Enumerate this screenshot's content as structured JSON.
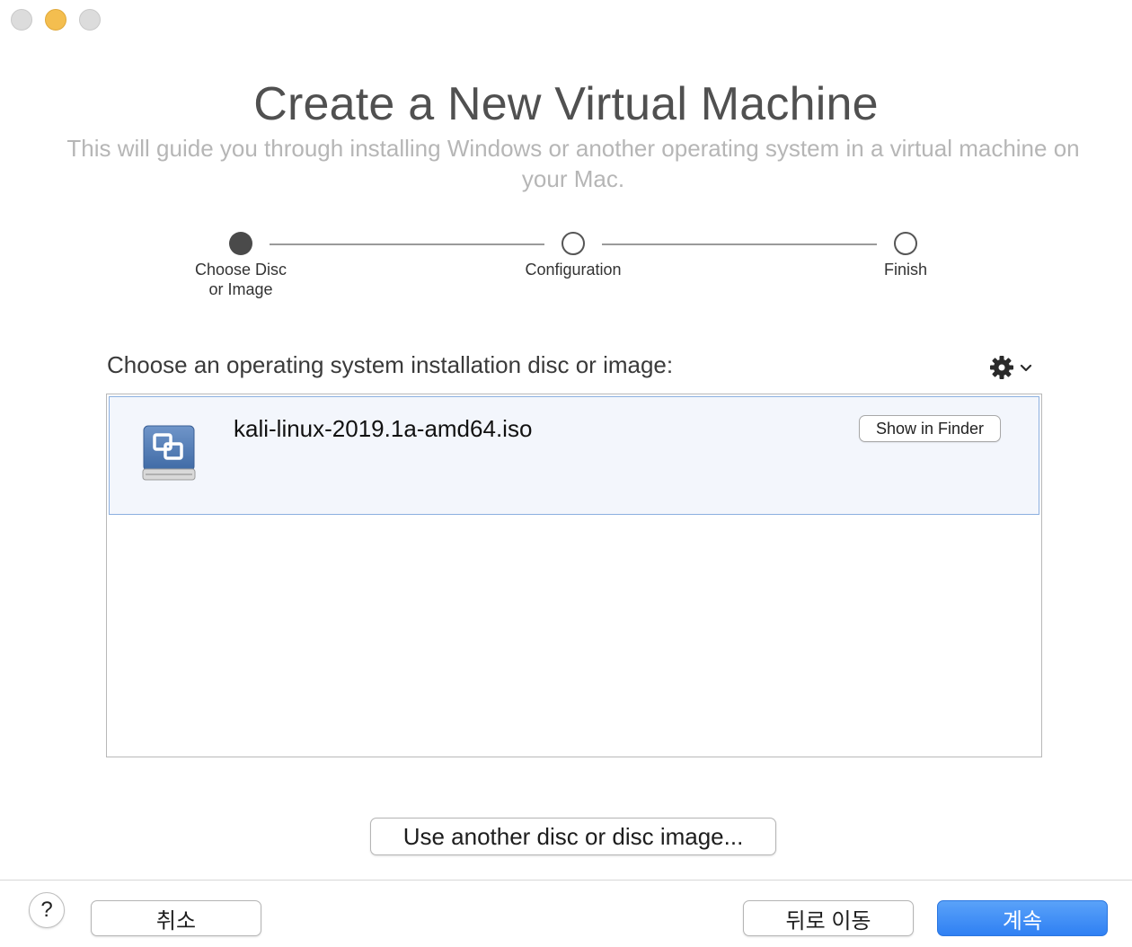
{
  "window": {
    "traffic_lights": [
      "close",
      "minimize",
      "zoom"
    ]
  },
  "header": {
    "title": "Create a New Virtual Machine",
    "subtitle": "This will guide you through installing Windows or another operating system in a virtual machine on your Mac."
  },
  "steps": [
    {
      "label": "Choose Disc\nor Image",
      "state": "active"
    },
    {
      "label": "Configuration",
      "state": "inactive"
    },
    {
      "label": "Finish",
      "state": "inactive"
    }
  ],
  "chooser": {
    "label": "Choose an operating system installation disc or image:",
    "gear_icon": "gear-icon",
    "items": [
      {
        "filename": "kali-linux-2019.1a-amd64.iso",
        "action_label": "Show in Finder",
        "icon": "disc-image-icon"
      }
    ],
    "another_label": "Use another disc or disc image..."
  },
  "footer": {
    "help_label": "?",
    "cancel_label": "취소",
    "back_label": "뒤로 이동",
    "continue_label": "계속"
  },
  "colors": {
    "accent": "#2f80f3",
    "selection_bg": "#f3f6fc",
    "selection_border": "#8cb0e0"
  }
}
